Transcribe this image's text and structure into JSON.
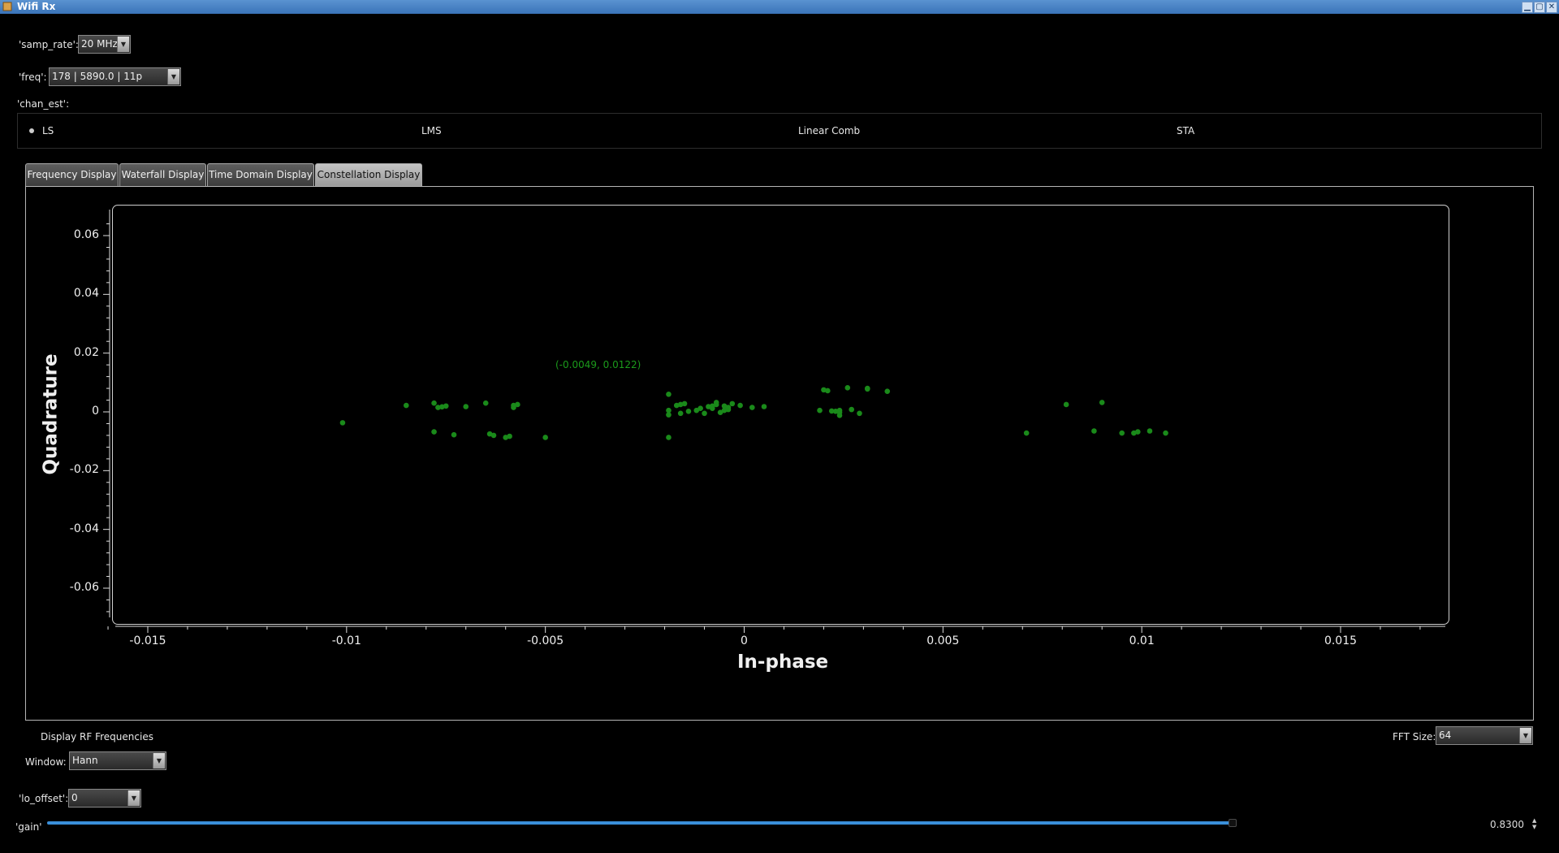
{
  "window": {
    "title": "Wifi Rx"
  },
  "controls": {
    "samp_rate": {
      "label": "'samp_rate':",
      "value": "20 MHz"
    },
    "freq": {
      "label": "'freq':",
      "value": "178 | 5890.0 | 11p"
    },
    "chan_est": {
      "label": "'chan_est':",
      "options": [
        "LS",
        "LMS",
        "Linear Comb",
        "STA"
      ],
      "selected": "LS"
    }
  },
  "tabs": [
    "Frequency Display",
    "Waterfall Display",
    "Time Domain Display",
    "Constellation Display"
  ],
  "active_tab": "Constellation Display",
  "plot": {
    "readout": "(-0.0049, 0.0122)"
  },
  "bottom": {
    "rf_freq_label": "Display RF Frequencies",
    "fft_size": {
      "label": "FFT Size:",
      "value": "64"
    },
    "window": {
      "label": "Window:",
      "value": "Hann"
    },
    "lo_offset": {
      "label": "'lo_offset':",
      "value": "0"
    },
    "gain": {
      "label": "'gain'",
      "value": 0.83,
      "display": "0.8300"
    }
  },
  "colors": {
    "points": "#1a8a1a",
    "slider": "#3a8fd9",
    "titlebar": "#4a83c6"
  },
  "chart_data": {
    "type": "scatter",
    "xlabel": "In-phase",
    "ylabel": "Quadrature",
    "xlim": [
      -0.0165,
      0.0176
    ],
    "ylim": [
      -0.0697,
      0.0697
    ],
    "xticks": [
      -0.015,
      -0.01,
      -0.005,
      0,
      0.005,
      0.01,
      0.015
    ],
    "xtick_labels": [
      "-0.015",
      "-0.01",
      "-0.005",
      "0",
      "0.005",
      "0.01",
      "0.015"
    ],
    "yticks": [
      0.06,
      0.04,
      0.02,
      0,
      -0.02,
      -0.04,
      -0.06
    ],
    "ytick_labels": [
      "0.06",
      "0.04",
      "0.02",
      "0",
      "-0.02",
      "-0.04",
      "-0.06"
    ],
    "points": [
      [
        -0.0101,
        -0.0037
      ],
      [
        -0.0085,
        0.0022
      ],
      [
        -0.0078,
        0.003
      ],
      [
        -0.0077,
        0.0015
      ],
      [
        -0.0076,
        0.0017
      ],
      [
        -0.0075,
        0.002
      ],
      [
        -0.007,
        0.0018
      ],
      [
        -0.0065,
        0.003
      ],
      [
        -0.0058,
        0.0015
      ],
      [
        -0.0058,
        0.0022
      ],
      [
        -0.0057,
        0.0025
      ],
      [
        -0.0078,
        -0.0068
      ],
      [
        -0.0073,
        -0.0078
      ],
      [
        -0.0064,
        -0.0075
      ],
      [
        -0.0063,
        -0.008
      ],
      [
        -0.006,
        -0.0087
      ],
      [
        -0.0059,
        -0.0083
      ],
      [
        -0.005,
        -0.0087
      ],
      [
        -0.0019,
        0.006
      ],
      [
        -0.0019,
        0.0005
      ],
      [
        -0.0019,
        -0.001
      ],
      [
        -0.0019,
        -0.0087
      ],
      [
        -0.0017,
        0.0022
      ],
      [
        -0.0016,
        0.0025
      ],
      [
        -0.0016,
        -0.0005
      ],
      [
        -0.0015,
        0.0028
      ],
      [
        -0.0014,
        0.0002
      ],
      [
        -0.0012,
        0.0005
      ],
      [
        -0.0011,
        0.0012
      ],
      [
        -0.001,
        -0.0005
      ],
      [
        -0.0009,
        0.0018
      ],
      [
        -0.0008,
        0.002
      ],
      [
        -0.0008,
        0.0012
      ],
      [
        -0.0007,
        0.0032
      ],
      [
        -0.0007,
        0.0025
      ],
      [
        -0.0006,
        -0.0002
      ],
      [
        -0.0005,
        0.0005
      ],
      [
        -0.0005,
        0.002
      ],
      [
        -0.0004,
        0.0008
      ],
      [
        -0.0004,
        0.0015
      ],
      [
        -0.0003,
        0.0028
      ],
      [
        -0.0001,
        0.0022
      ],
      [
        0.0002,
        0.0015
      ],
      [
        0.0005,
        0.0018
      ],
      [
        0.0019,
        0.0005
      ],
      [
        0.002,
        0.0075
      ],
      [
        0.0021,
        0.0072
      ],
      [
        0.0022,
        0.0003
      ],
      [
        0.0023,
        0.0002
      ],
      [
        0.0024,
        0.0005
      ],
      [
        0.0024,
        -0.0002
      ],
      [
        0.0024,
        -0.0012
      ],
      [
        0.0026,
        0.0082
      ],
      [
        0.0027,
        0.0008
      ],
      [
        0.0029,
        -0.0005
      ],
      [
        0.0031,
        0.0078
      ],
      [
        0.0031,
        0.008
      ],
      [
        0.0036,
        0.007
      ],
      [
        0.0071,
        -0.0072
      ],
      [
        0.0081,
        0.0025
      ],
      [
        0.0088,
        -0.0065
      ],
      [
        0.009,
        0.0032
      ],
      [
        0.0095,
        -0.0072
      ],
      [
        0.0098,
        -0.0072
      ],
      [
        0.0099,
        -0.0068
      ],
      [
        0.0102,
        -0.0065
      ],
      [
        0.0106,
        -0.0072
      ]
    ]
  }
}
